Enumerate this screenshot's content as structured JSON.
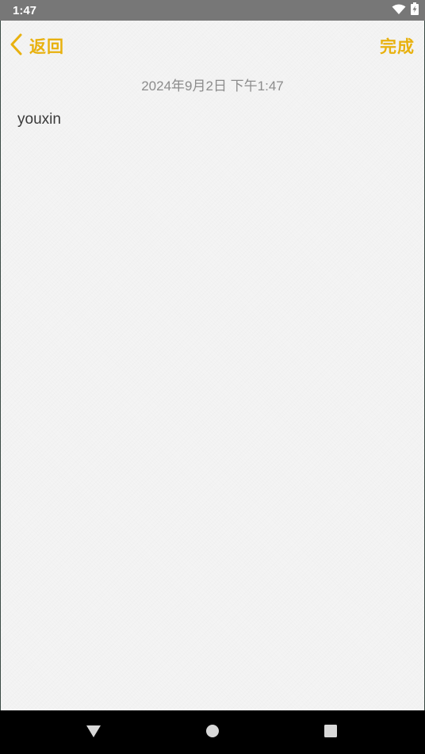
{
  "status_bar": {
    "time": "1:47",
    "icons": [
      "wifi-icon",
      "battery-charging-icon"
    ]
  },
  "toolbar": {
    "back_label": "返回",
    "done_label": "完成",
    "back_icon": "chevron-left-icon"
  },
  "note": {
    "date": "2024年9月2日 下午1:47",
    "body": "youxin"
  },
  "nav_bar": {
    "icons": [
      "back-triangle-icon",
      "home-circle-icon",
      "recents-square-icon"
    ]
  },
  "colors": {
    "accent": "#e8b10e",
    "status_bar": "#777777",
    "paper": "#f4f4f4",
    "date_text": "#8c8c8c",
    "body_text": "#3a3a3a",
    "nav_bar": "#000000"
  }
}
